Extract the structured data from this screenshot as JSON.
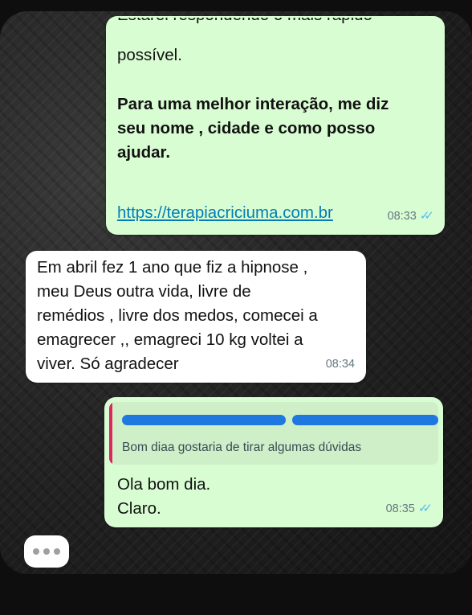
{
  "messages": {
    "m1": {
      "partial_top": "Estarei respondendo o mais rápido",
      "line": "possível.",
      "bold_text": "Para uma melhor interação, me diz\nseu nome , cidade e como posso\najudar.",
      "link": "https://terapiacriciuma.com.br",
      "time": "08:33",
      "status_icon": "double-check-read"
    },
    "m2": {
      "text": "Em abril fez 1 ano que fiz a hipnose ,\nmeu Deus outra vida, livre de\nremédios , livre dos medos, comecei a\nemagrecer ,, emagreci 10 kg  voltei a\nviver. Só agradecer",
      "time": "08:34"
    },
    "m3": {
      "quoted_text": "Bom diaa gostaria de tirar algumas dúvidas",
      "text": "Ola bom dia.\nClaro.",
      "time": "08:35",
      "status_icon": "double-check-read"
    }
  },
  "typing_indicator": "typing-dots",
  "colors": {
    "outgoing_bubble": "#d9fdd3",
    "incoming_bubble": "#ffffff",
    "link": "#027eb5",
    "read_ticks": "#53bdeb",
    "quote_bar": "#e0245e",
    "redaction": "#1e78e0"
  }
}
